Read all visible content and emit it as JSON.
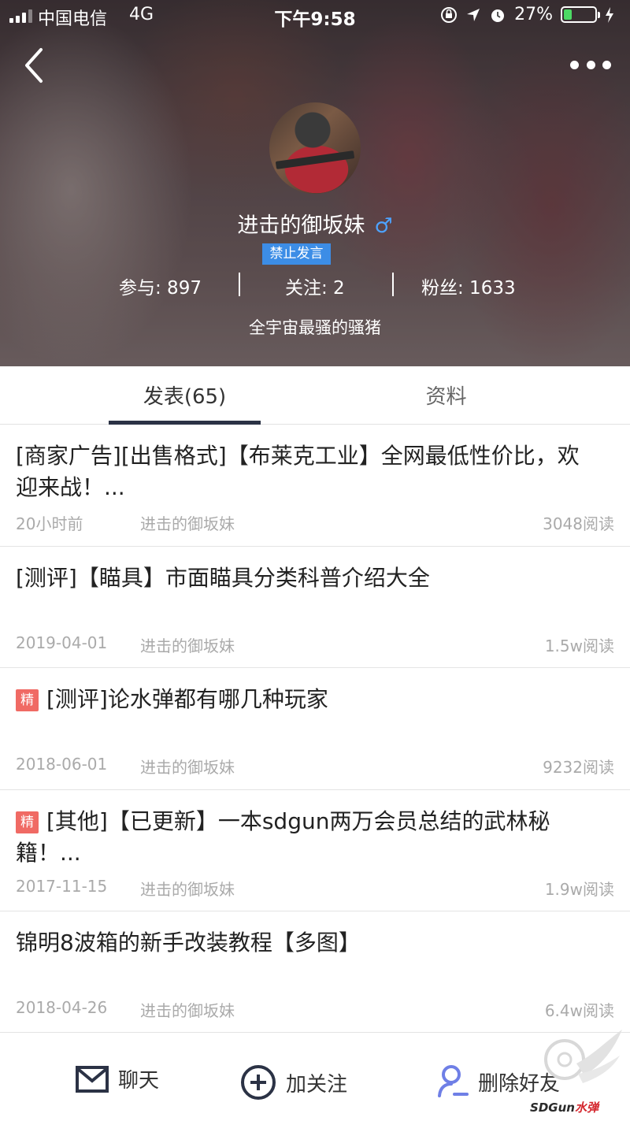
{
  "status_bar": {
    "carrier": "中国电信",
    "network": "4G",
    "time": "下午9:58",
    "battery_percent": "27%",
    "battery_level": 0.27
  },
  "profile": {
    "username": "进击的御坂妹",
    "gender_symbol": "♂",
    "badge": "禁止发言",
    "stats": {
      "participate": "参与: 897",
      "follow": "关注: 2",
      "fans": "粉丝: 1633"
    },
    "bio": "全宇宙最骚的骚猪"
  },
  "tabs": [
    {
      "label": "发表(65)",
      "active": true
    },
    {
      "label": "资料",
      "active": false
    }
  ],
  "posts": [
    {
      "tag": "",
      "title": "[商家广告][出售格式]【布莱克工业】全网最低性价比，欢迎来战！...",
      "date": "20小时前",
      "author": "进击的御坂妹",
      "reads": "3048阅读"
    },
    {
      "tag": "",
      "title": "[测评]【瞄具】市面瞄具分类科普介绍大全",
      "date": "2019-04-01",
      "author": "进击的御坂妹",
      "reads": "1.5w阅读"
    },
    {
      "tag": "精",
      "title": "[测评]论水弹都有哪几种玩家",
      "date": "2018-06-01",
      "author": "进击的御坂妹",
      "reads": "9232阅读"
    },
    {
      "tag": "精",
      "title": "[其他]【已更新】一本sdgun两万会员总结的武林秘籍！...",
      "date": "2017-11-15",
      "author": "进击的御坂妹",
      "reads": "1.9w阅读"
    },
    {
      "tag": "",
      "title": "锦明8波箱的新手改装教程【多图】",
      "date": "2018-04-26",
      "author": "进击的御坂妹",
      "reads": "6.4w阅读"
    }
  ],
  "bottom_bar": {
    "chat": "聊天",
    "follow": "加关注",
    "unfriend": "删除好友"
  },
  "watermark": {
    "brand": "SDGun",
    "suffix": "水弹"
  },
  "colors": {
    "badge": "#3c8de6",
    "jing_tag": "#f06a64",
    "gender": "#4da3ff",
    "tab_underline": "#2b3245",
    "unfriend_icon": "#6f7fe6"
  }
}
